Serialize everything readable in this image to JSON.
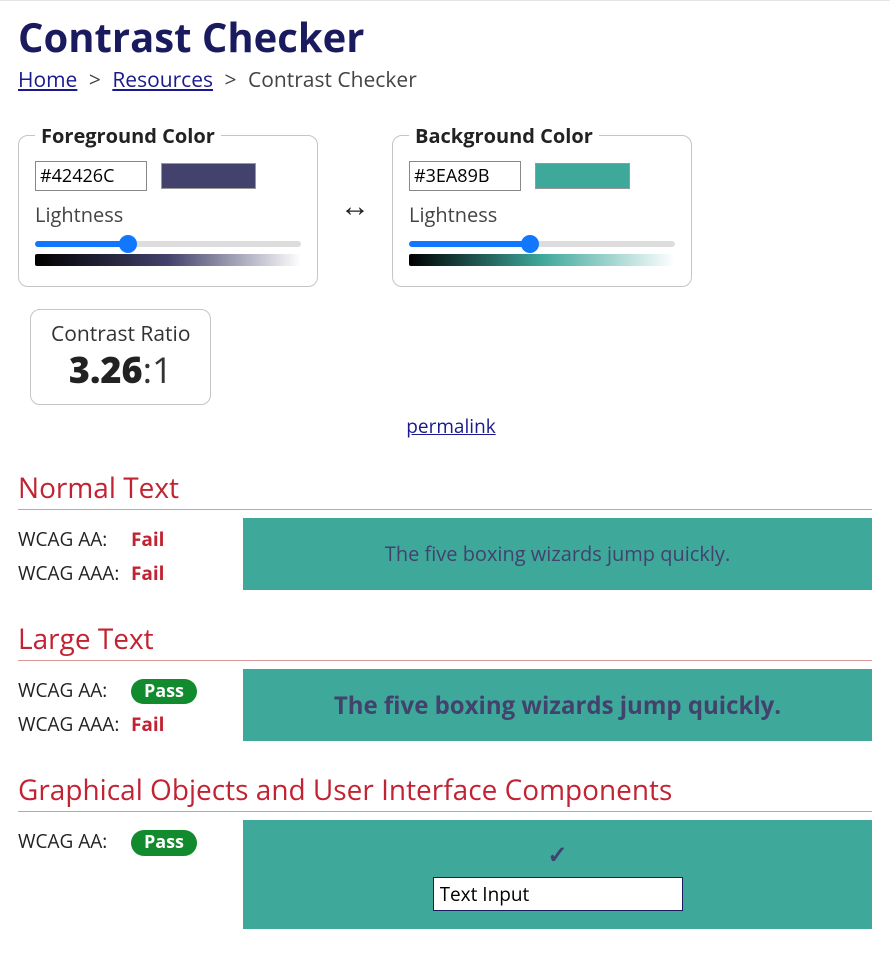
{
  "page_title": "Contrast Checker",
  "breadcrumb": {
    "home": "Home",
    "resources": "Resources",
    "current": "Contrast Checker",
    "sep": ">"
  },
  "foreground": {
    "legend": "Foreground Color",
    "hex": "#42426C",
    "lightness_label": "Lightness",
    "lightness_value": 34
  },
  "background": {
    "legend": "Background Color",
    "hex": "#3EA89B",
    "lightness_label": "Lightness",
    "lightness_value": 45
  },
  "contrast": {
    "title": "Contrast Ratio",
    "ratio": "3.26",
    "suffix": ":1",
    "permalink": "permalink"
  },
  "sections": {
    "normal": {
      "heading": "Normal Text",
      "aa_label": "WCAG AA:",
      "aa_result": "Fail",
      "aa_pass": false,
      "aaa_label": "WCAG AAA:",
      "aaa_result": "Fail",
      "aaa_pass": false,
      "sample": "The five boxing wizards jump quickly."
    },
    "large": {
      "heading": "Large Text",
      "aa_label": "WCAG AA:",
      "aa_result": "Pass",
      "aa_pass": true,
      "aaa_label": "WCAG AAA:",
      "aaa_result": "Fail",
      "aaa_pass": false,
      "sample": "The five boxing wizards jump quickly."
    },
    "graphical": {
      "heading": "Graphical Objects and User Interface Components",
      "aa_label": "WCAG AA:",
      "aa_result": "Pass",
      "aa_pass": true,
      "input_value": "Text Input"
    }
  }
}
